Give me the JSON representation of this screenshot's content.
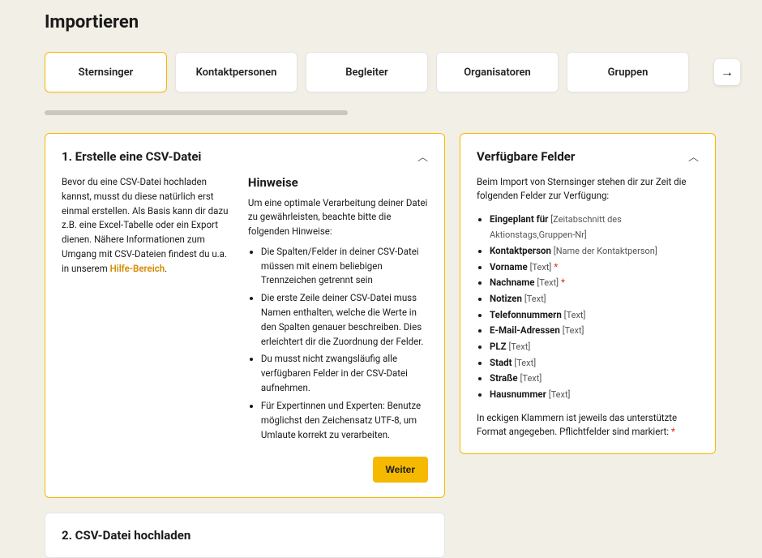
{
  "page": {
    "title": "Importieren"
  },
  "tabs": {
    "items": [
      {
        "label": "Sternsinger",
        "active": true
      },
      {
        "label": "Kontaktpersonen",
        "active": false
      },
      {
        "label": "Begleiter",
        "active": false
      },
      {
        "label": "Organisatoren",
        "active": false
      },
      {
        "label": "Gruppen",
        "active": false
      }
    ]
  },
  "step1": {
    "title": "1. Erstelle eine CSV-Datei",
    "intro_prefix": "Bevor du eine CSV-Datei hochladen kannst, musst du diese natürlich erst einmal erstellen. Als Basis kann dir dazu z.B. eine Excel-Tabelle oder ein Export dienen. Nähere Informationen zum Umgang mit CSV-Dateien findest du u.a. in unserem ",
    "intro_link": "Hilfe-Bereich",
    "intro_suffix": ".",
    "hints_heading": "Hinweise",
    "hints_intro": "Um eine optimale Verarbeitung deiner Datei zu gewährleisten, beachte bitte die folgenden Hinweise:",
    "hints": [
      "Die Spalten/Felder in deiner CSV-Datei müssen mit einem beliebigen Trennzeichen getrennt sein",
      "Die erste Zeile deiner CSV-Datei muss Namen enthalten, welche die Werte in den Spalten genauer beschreiben. Dies erleichtert dir die Zuordnung der Felder.",
      "Du musst nicht zwangsläufig alle verfügbaren Felder in der CSV-Datei aufnehmen.",
      "Für Expertinnen und Experten: Benutze möglichst den Zeichensatz UTF-8, um Umlaute korrekt zu verarbeiten."
    ],
    "continue_label": "Weiter"
  },
  "step2": {
    "title": "2. CSV-Datei hochladen"
  },
  "fields_panel": {
    "title": "Verfügbare Felder",
    "intro": "Beim Import von Sternsinger stehen dir zur Zeit die folgenden Felder zur Verfügung:",
    "fields": [
      {
        "name": "Eingeplant für",
        "format": "[Zeitabschnitt des Aktionstags,Gruppen-Nr]",
        "required": false
      },
      {
        "name": "Kontaktperson",
        "format": "[Name der Kontaktperson]",
        "required": false
      },
      {
        "name": "Vorname",
        "format": "[Text]",
        "required": true
      },
      {
        "name": "Nachname",
        "format": "[Text]",
        "required": true
      },
      {
        "name": "Notizen",
        "format": "[Text]",
        "required": false
      },
      {
        "name": "Telefonnummern",
        "format": "[Text]",
        "required": false
      },
      {
        "name": "E-Mail-Adressen",
        "format": "[Text]",
        "required": false
      },
      {
        "name": "PLZ",
        "format": "[Text]",
        "required": false
      },
      {
        "name": "Stadt",
        "format": "[Text]",
        "required": false
      },
      {
        "name": "Straße",
        "format": "[Text]",
        "required": false
      },
      {
        "name": "Hausnummer",
        "format": "[Text]",
        "required": false
      }
    ],
    "note_prefix": "In eckigen Klammern ist jeweils das unterstützte Format angegeben. Pflichtfelder sind markiert: ",
    "note_marker": "*"
  }
}
